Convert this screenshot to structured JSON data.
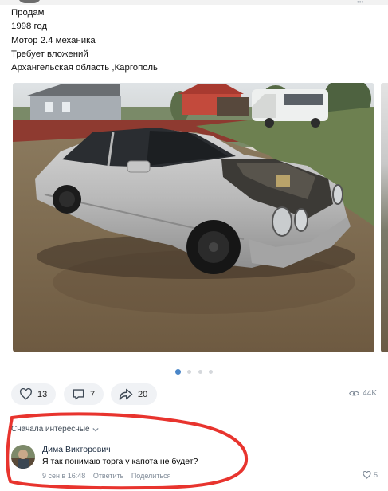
{
  "post": {
    "lines": [
      "Продам",
      "1998 год",
      "Мотор 2.4 механика",
      "Требует вложений",
      "Архангельская область ,Каргополь"
    ]
  },
  "photo": {
    "description_icon": "photo-of-car"
  },
  "carousel": {
    "count": 4,
    "active_index": 0
  },
  "actions": {
    "likes": "13",
    "comments": "7",
    "shares": "20",
    "views": "44K"
  },
  "comments": {
    "sort_label": "Сначала интересные",
    "items": [
      {
        "author": "Дима Викторович",
        "text": "Я так понимаю торга у капота не будет?",
        "time": "9 сен в 16:48",
        "reply_label": "Ответить",
        "share_label": "Поделиться",
        "likes": "5"
      }
    ]
  },
  "colors": {
    "accent": "#4a86c8",
    "highlight": "#e8342e",
    "pill_bg": "#f0f2f5",
    "muted": "#818c99"
  }
}
